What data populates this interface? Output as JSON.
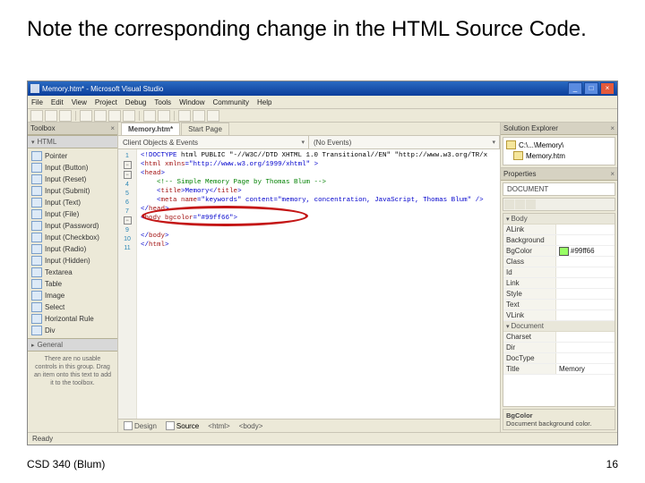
{
  "slide": {
    "title": "Note the corresponding change in the HTML Source Code.",
    "footer_left": "CSD 340 (Blum)",
    "footer_right": "16"
  },
  "window": {
    "title": "Memory.htm* - Microsoft Visual Studio",
    "btn_min": "_",
    "btn_max": "□",
    "btn_close": "×"
  },
  "menu": [
    "File",
    "Edit",
    "View",
    "Project",
    "Debug",
    "Tools",
    "Window",
    "Community",
    "Help"
  ],
  "toolbox": {
    "header": "Toolbox",
    "close": "×",
    "band_html": "HTML",
    "items": [
      "Pointer",
      "Input (Button)",
      "Input (Reset)",
      "Input (Submit)",
      "Input (Text)",
      "Input (File)",
      "Input (Password)",
      "Input (Checkbox)",
      "Input (Radio)",
      "Input (Hidden)",
      "Textarea",
      "Table",
      "Image",
      "Select",
      "Horizontal Rule",
      "Div"
    ],
    "band_general": "General",
    "note": "There are no usable controls in this group. Drag an item onto this text to add it to the toolbox."
  },
  "doc": {
    "tabs": [
      "Memory.htm*",
      "Start Page"
    ],
    "drop_left": "Client Objects & Events",
    "drop_right": "(No Events)"
  },
  "code": {
    "l1a": "<!DOCTYPE",
    "l1b": " html PUBLIC \"-//W3C//DTD XHTML 1.0 Transitional//EN\" \"http://www.w3.org/TR/x",
    "l2a": "<",
    "l2b": "html",
    "l2c": " xmlns",
    "l2d": "=\"http://www.w3.org/1999/xhtml\" >",
    "l3a": "<",
    "l3b": "head",
    "l3c": ">",
    "l4": "    <!-- Simple Memory Page by Thomas Blum -->",
    "l5a": "    <",
    "l5b": "title",
    "l5c": ">Memory</",
    "l5d": "title",
    "l5e": ">",
    "l6a": "    <",
    "l6b": "meta",
    "l6c": " name",
    "l6d": "=\"keywords\" content=\"memory, concentration, JavaScript, Thomas Blum\" />",
    "l7a": "</",
    "l7b": "head",
    "l7c": ">",
    "l8a": "<",
    "l8b": "body",
    "l8c": " bgcolor",
    "l8d": "=\"#99ff66\">",
    "l9": "",
    "l10a": "</",
    "l10b": "body",
    "l10c": ">",
    "l11a": "</",
    "l11b": "html",
    "l11c": ">"
  },
  "bottom": {
    "design": "Design",
    "source": "Source",
    "split_l": "<html>",
    "split_r": "<body>"
  },
  "status": {
    "ready": "Ready"
  },
  "solution": {
    "header": "Solution Explorer",
    "close": "×",
    "root": "C:\\...\\Memory\\",
    "file": "Memory.htm"
  },
  "props": {
    "header": "Properties",
    "close": "×",
    "obj": "DOCUMENT",
    "cat_body": "Body",
    "rows_body": [
      {
        "k": "ALink",
        "v": ""
      },
      {
        "k": "Background",
        "v": ""
      },
      {
        "k": "BgColor",
        "v": "#99ff66",
        "sw": true
      },
      {
        "k": "Class",
        "v": ""
      },
      {
        "k": "Id",
        "v": ""
      },
      {
        "k": "Link",
        "v": ""
      },
      {
        "k": "Style",
        "v": ""
      },
      {
        "k": "Text",
        "v": ""
      },
      {
        "k": "VLink",
        "v": ""
      }
    ],
    "cat_doc": "Document",
    "rows_doc": [
      {
        "k": "Charset",
        "v": ""
      },
      {
        "k": "Dir",
        "v": ""
      },
      {
        "k": "DocType",
        "v": ""
      },
      {
        "k": "Title",
        "v": "Memory"
      }
    ],
    "desc_t": "BgColor",
    "desc_b": "Document background color."
  }
}
